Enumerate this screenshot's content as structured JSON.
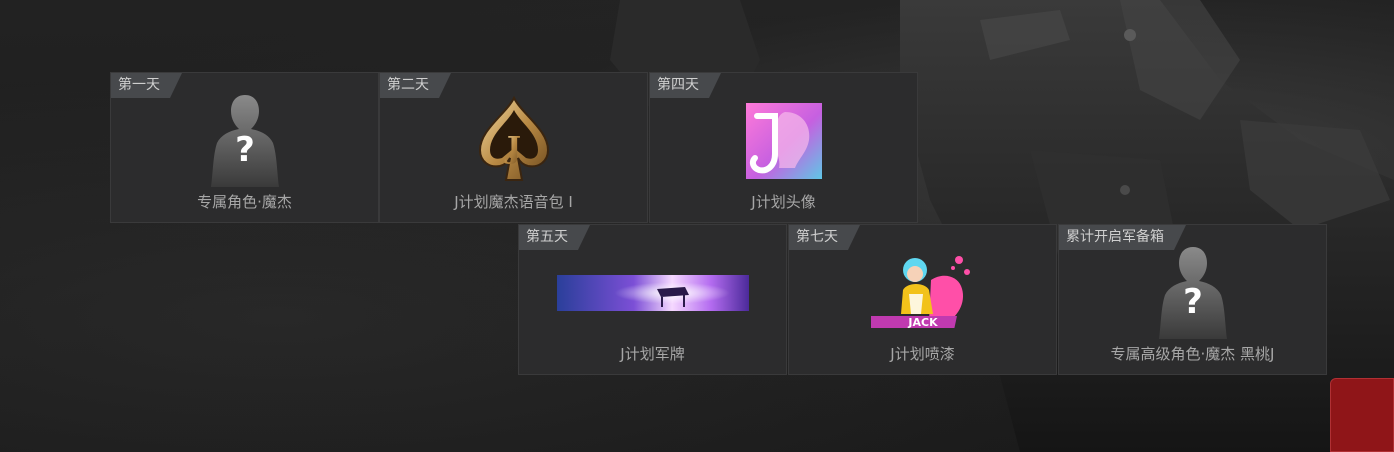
{
  "rewards": [
    {
      "day": "第一天",
      "name": "专属角色·魔杰",
      "icon": "mystery-character-icon"
    },
    {
      "day": "第二天",
      "name": "J计划魔杰语音包 I",
      "icon": "spade-j-voice-pack-icon"
    },
    {
      "day": "第四天",
      "name": "J计划头像",
      "icon": "j-avatar-icon"
    },
    {
      "day": "第五天",
      "name": "J计划军牌",
      "icon": "piano-dog-tag-banner-icon"
    },
    {
      "day": "第七天",
      "name": "J计划喷漆",
      "icon": "graffiti-spray-icon"
    },
    {
      "day": "累计开启军备箱",
      "name": "专属高级角色·魔杰 黑桃J",
      "icon": "mystery-character-icon"
    }
  ],
  "colors": {
    "card_bg": "#2c2c2d",
    "tag_bg": "#47494c",
    "label_text": "#a7a7a7",
    "accent_red": "#8f1518"
  }
}
